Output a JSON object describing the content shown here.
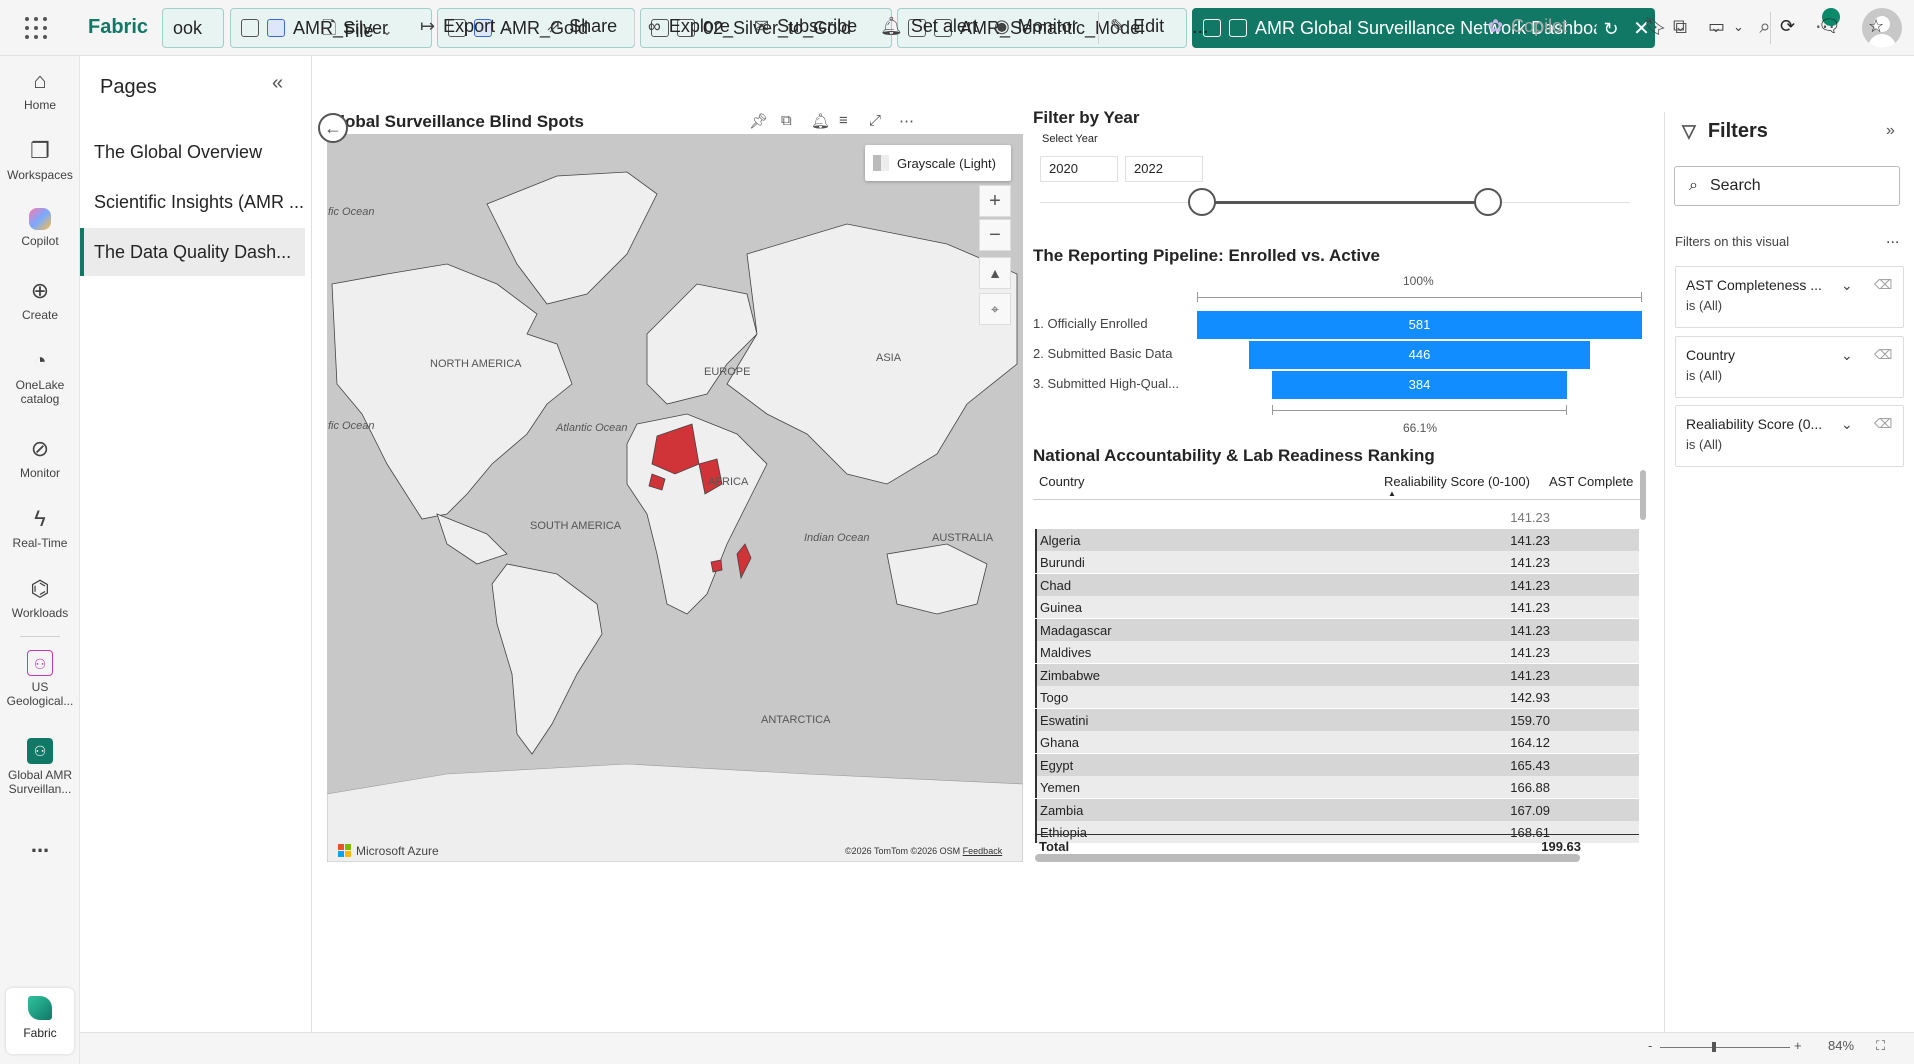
{
  "app": {
    "brand": "Fabric"
  },
  "tabs": [
    {
      "label": "ook"
    },
    {
      "label": "AMR_Silver"
    },
    {
      "label": "AMR_Gold"
    },
    {
      "label": "02_Silver_to_Gold"
    },
    {
      "label": "AMR_Semantic_Model"
    },
    {
      "label": "AMR Global Surveillance Network Dashboard"
    }
  ],
  "rail": [
    {
      "label": "Home",
      "icon": "home-icon"
    },
    {
      "label": "Workspaces",
      "icon": "workspaces-icon"
    },
    {
      "label": "Copilot",
      "icon": "copilot-icon"
    },
    {
      "label": "Create",
      "icon": "plus-circle-icon"
    },
    {
      "label": "OneLake catalog",
      "icon": "onelake-icon"
    },
    {
      "label": "Monitor",
      "icon": "monitor-icon"
    },
    {
      "label": "Real-Time",
      "icon": "lightning-icon"
    },
    {
      "label": "Workloads",
      "icon": "workloads-icon"
    },
    {
      "label": "US Geological...",
      "icon": "us-geological-icon"
    },
    {
      "label": "Global AMR Surveillan...",
      "icon": "global-amr-icon"
    }
  ],
  "rail_more": "...",
  "fabric_label": "Fabric",
  "pages": {
    "title": "Pages",
    "items": [
      {
        "label": "The Global Overview"
      },
      {
        "label": "Scientific Insights (AMR ..."
      },
      {
        "label": "The Data Quality Dash..."
      }
    ]
  },
  "toolbar": {
    "file": "File",
    "export": "Export",
    "share": "Share",
    "explore": "Explore",
    "subscribe": "Subscribe",
    "set_alert": "Set alert",
    "monitor": "Monitor",
    "edit": "Edit",
    "more": "...",
    "copilot": "Copilot"
  },
  "map": {
    "title": "Global Surveillance Blind Spots",
    "style_label": "Grayscale (Light)",
    "labels": {
      "north_america": "NORTH AMERICA",
      "south_america": "SOUTH AMERICA",
      "europe": "EUROPE",
      "asia": "ASIA",
      "africa": "AFRICA",
      "australia": "AUSTRALIA",
      "antarctica": "ANTARCTICA",
      "atlantic": "Atlantic Ocean",
      "indian": "Indian Ocean",
      "pacific_n": "fic Ocean",
      "pacific_s": "fic Ocean"
    },
    "provider": "Microsoft Azure",
    "attribution": "©2026 TomTom  ©2026 OSM",
    "feedback": "Feedback",
    "highlight_color": "#d13438"
  },
  "slicer": {
    "title": "Filter by Year",
    "subtitle": "Select Year",
    "from": "2020",
    "to": "2022"
  },
  "funnel": {
    "title": "The Reporting Pipeline: Enrolled vs. Active",
    "top_pct": "100%",
    "bottom_pct": "66.1%",
    "stages": [
      {
        "label": "1. Officially Enrolled",
        "value": 581
      },
      {
        "label": "2. Submitted Basic Data",
        "value": 446
      },
      {
        "label": "3. Submitted High-Qual...",
        "value": 384
      }
    ],
    "color": "#118dff"
  },
  "table": {
    "title": "National Accountability & Lab Readiness Ranking",
    "columns": [
      "Country",
      "Realiability Score (0-100)",
      "AST Complete"
    ],
    "rows": [
      {
        "country": "",
        "score": "141.23"
      },
      {
        "country": "Algeria",
        "score": "141.23"
      },
      {
        "country": "Burundi",
        "score": "141.23"
      },
      {
        "country": "Chad",
        "score": "141.23"
      },
      {
        "country": "Guinea",
        "score": "141.23"
      },
      {
        "country": "Madagascar",
        "score": "141.23"
      },
      {
        "country": "Maldives",
        "score": "141.23"
      },
      {
        "country": "Zimbabwe",
        "score": "141.23"
      },
      {
        "country": "Togo",
        "score": "142.93"
      },
      {
        "country": "Eswatini",
        "score": "159.70"
      },
      {
        "country": "Ghana",
        "score": "164.12"
      },
      {
        "country": "Egypt",
        "score": "165.43"
      },
      {
        "country": "Yemen",
        "score": "166.88"
      },
      {
        "country": "Zambia",
        "score": "167.09"
      },
      {
        "country": "Ethiopia",
        "score": "168.61"
      }
    ],
    "total_label": "Total",
    "total_value": "199.63"
  },
  "filters": {
    "title": "Filters",
    "search_placeholder": "Search",
    "section": "Filters on this visual",
    "more": "...",
    "cards": [
      {
        "name": "AST Completeness ...",
        "value": "is (All)"
      },
      {
        "name": "Country",
        "value": "is (All)"
      },
      {
        "name": "Realiability Score (0...",
        "value": "is (All)"
      }
    ]
  },
  "status": {
    "zoom": "84%",
    "minus": "-",
    "plus": "+"
  }
}
